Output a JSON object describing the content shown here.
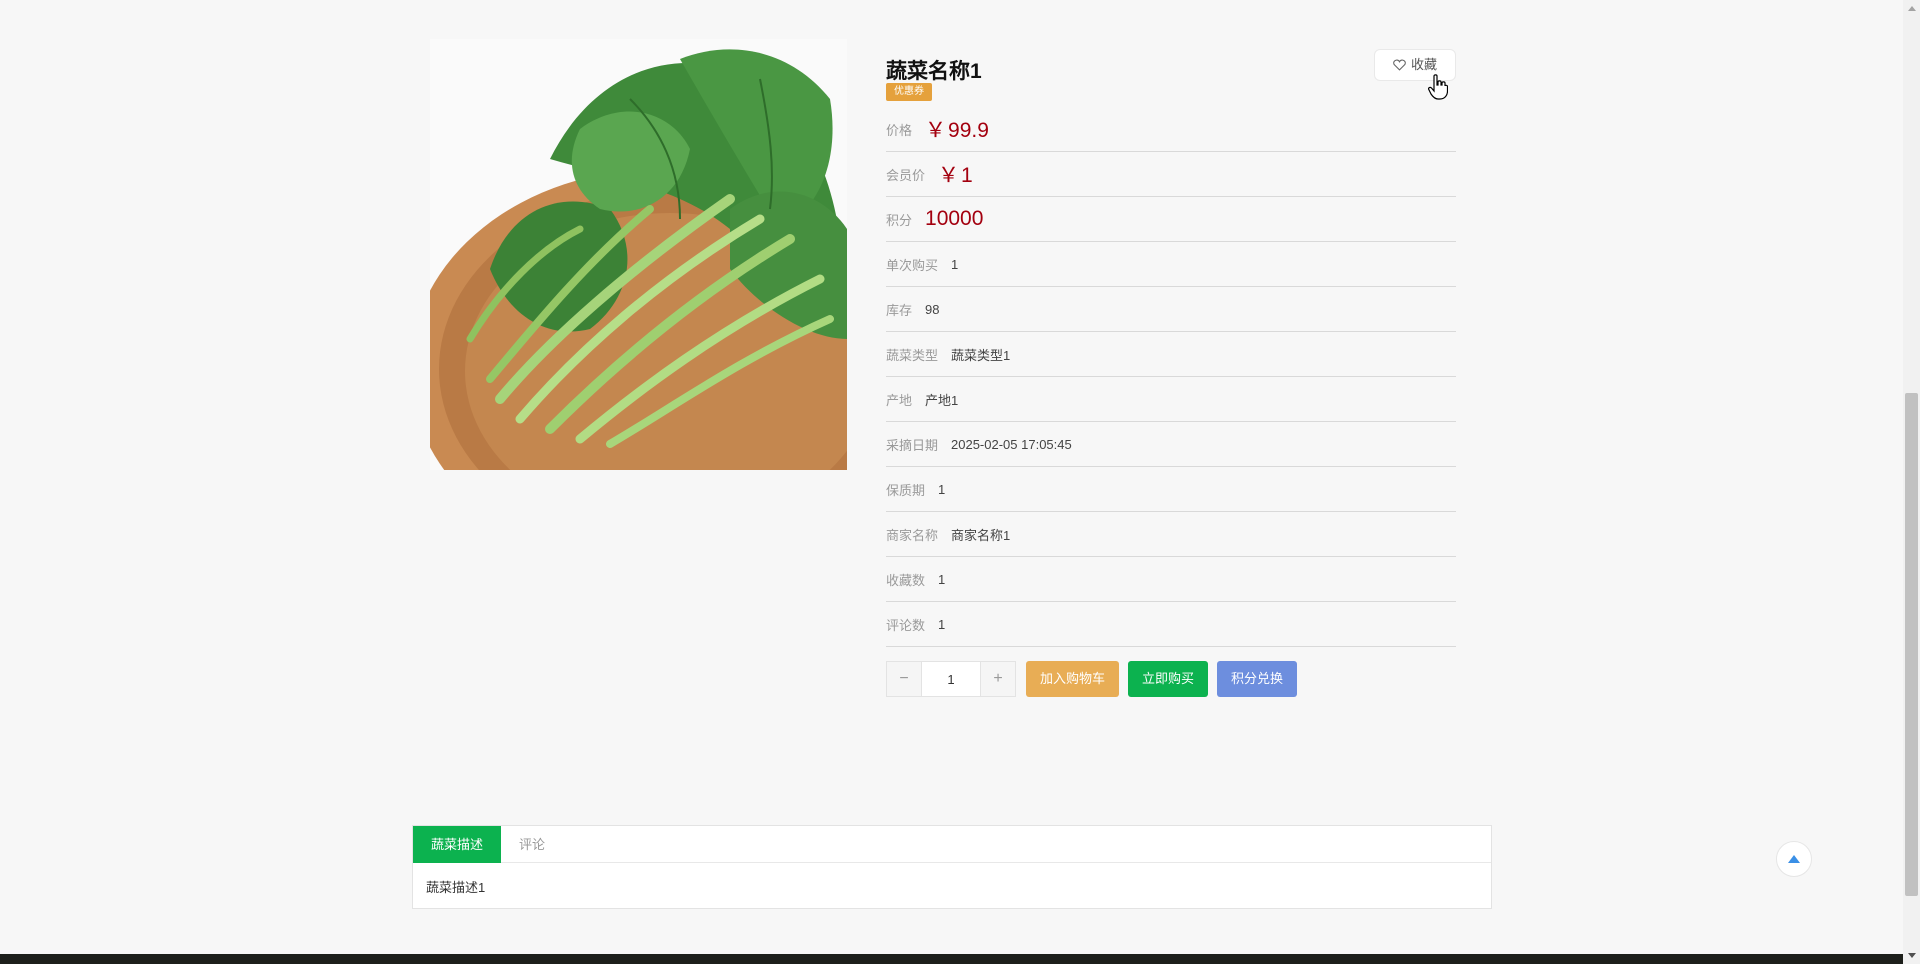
{
  "product": {
    "title": "蔬菜名称1",
    "tag": "优惠券",
    "favorite_label": "收藏"
  },
  "details": [
    {
      "label": "价格",
      "value": "99.9",
      "currency": "￥",
      "emphasis": true
    },
    {
      "label": "会员价",
      "value": "1",
      "currency": "￥",
      "emphasis": true
    },
    {
      "label": "积分",
      "value": "10000",
      "emphasis": true
    },
    {
      "label": "单次购买",
      "value": "1"
    },
    {
      "label": "库存",
      "value": "98"
    },
    {
      "label": "蔬菜类型",
      "value": "蔬菜类型1"
    },
    {
      "label": "产地",
      "value": "产地1"
    },
    {
      "label": "采摘日期",
      "value": "2025-02-05 17:05:45"
    },
    {
      "label": "保质期",
      "value": "1"
    },
    {
      "label": "商家名称",
      "value": "商家名称1"
    },
    {
      "label": "收藏数",
      "value": "1"
    },
    {
      "label": "评论数",
      "value": "1"
    }
  ],
  "purchase": {
    "minus": "−",
    "plus": "+",
    "quantity": "1",
    "add_to_cart": "加入购物车",
    "buy_now": "立即购买",
    "points_exchange": "积分兑换"
  },
  "tabs": {
    "items": [
      "蔬菜描述",
      "评论"
    ],
    "active": 0,
    "content": "蔬菜描述1"
  },
  "colors": {
    "price": "#a3000f",
    "accent_green": "#0cb24f",
    "cart_orange": "#e8ad55",
    "points_blue": "#6d8ede"
  }
}
